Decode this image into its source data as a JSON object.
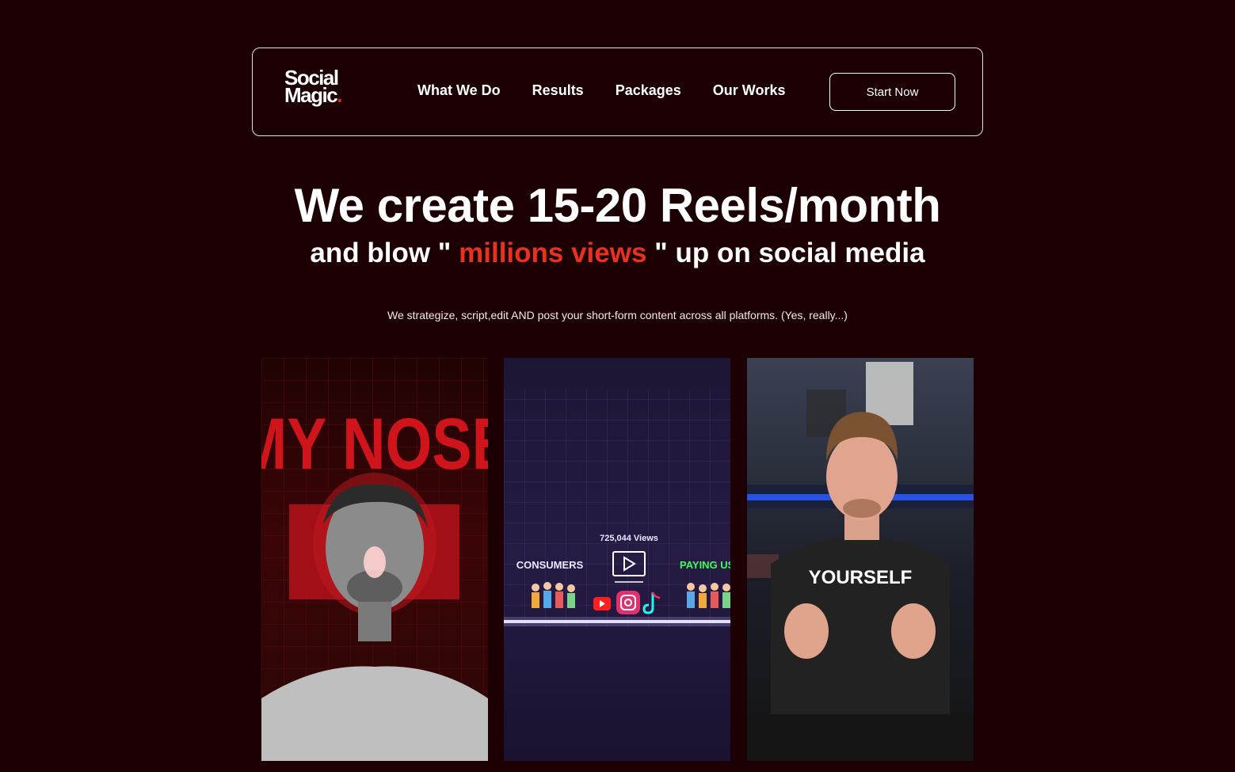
{
  "brand": {
    "logo_line1": "Social",
    "logo_line2": "Magic",
    "accent_color": "#e0251b"
  },
  "nav": {
    "links": [
      "What We Do",
      "Results",
      "Packages",
      "Our Works"
    ],
    "cta_label": "Start Now"
  },
  "hero": {
    "title": "We create 15-20 Reels/month",
    "subtitle_before": "and blow \" ",
    "subtitle_accent": "millions views",
    "subtitle_after": " \" up on social media",
    "description": "We strategize, script,edit AND post your short-form content across all platforms. (Yes, really...)"
  },
  "videos": [
    {
      "overlay_text": "MY NOSE"
    },
    {
      "views_text": "725,044 Views",
      "label_left": "CONSUMERS",
      "label_right": "PAYING US"
    },
    {
      "caption": "YOURSELF"
    }
  ],
  "colors": {
    "background": "#1c0003",
    "accent": "#e8321f",
    "text": "#ffffff"
  }
}
